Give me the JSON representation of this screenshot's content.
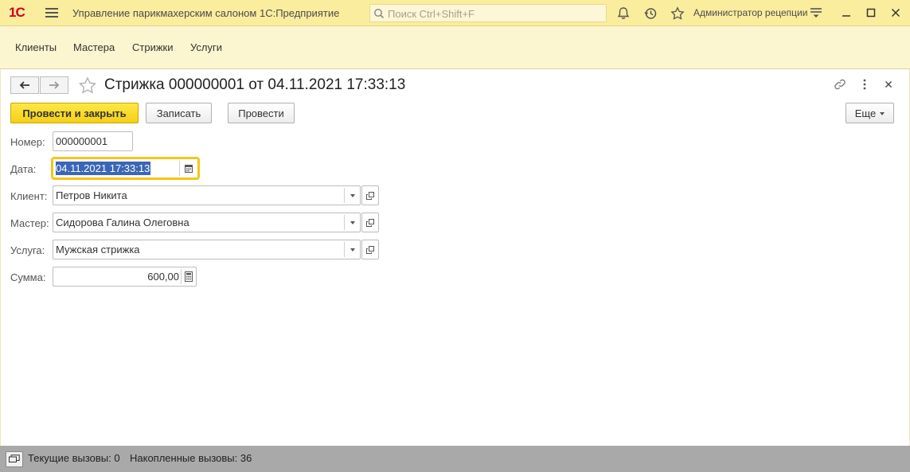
{
  "app": {
    "logo": "1С",
    "title": "Управление парикмахерским салоном 1С:Предприятие",
    "search_placeholder": "Поиск Ctrl+Shift+F",
    "user": "Администратор рецепции"
  },
  "sections": [
    "Клиенты",
    "Мастера",
    "Стрижки",
    "Услуги"
  ],
  "form": {
    "title": "Стрижка 000000001 от 04.11.2021 17:33:13",
    "buttons": {
      "post_close": "Провести и закрыть",
      "save": "Записать",
      "post": "Провести",
      "more": "Еще"
    },
    "fields": {
      "number": {
        "label": "Номер:",
        "value": "000000001"
      },
      "date": {
        "label": "Дата:",
        "value": "04.11.2021 17:33:13"
      },
      "client": {
        "label": "Клиент:",
        "value": "Петров Никита"
      },
      "master": {
        "label": "Мастер:",
        "value": "Сидорова Галина Олеговна"
      },
      "service": {
        "label": "Услуга:",
        "value": "Мужская стрижка"
      },
      "sum": {
        "label": "Сумма:",
        "value": "600,00"
      }
    }
  },
  "status": {
    "current_calls": "Текущие вызовы: 0",
    "accumulated_calls": "Накопленные вызовы: 36"
  }
}
